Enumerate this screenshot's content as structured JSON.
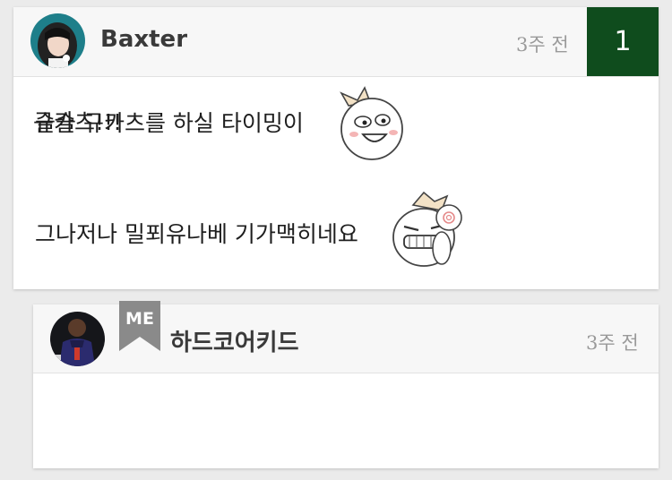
{
  "comment": {
    "username": "Baxter",
    "time": "3주 전",
    "like_count": "1",
    "lines": [
      "슬슬 규카츠를 하실 타이밍이",
      "그나저나 밀푀유나베 기가맥히네요"
    ],
    "emoticons": [
      "grinning-face-emoticon",
      "laughing-face-emoticon"
    ]
  },
  "reply": {
    "badge": "ME",
    "username": "하드코어키드",
    "time": "3주 전",
    "text": "규카츠!!!"
  },
  "colors": {
    "like_badge": "#0f4c1d",
    "me_badge": "#8a8a8a",
    "background": "#ebebeb",
    "header": "#f7f7f7"
  }
}
